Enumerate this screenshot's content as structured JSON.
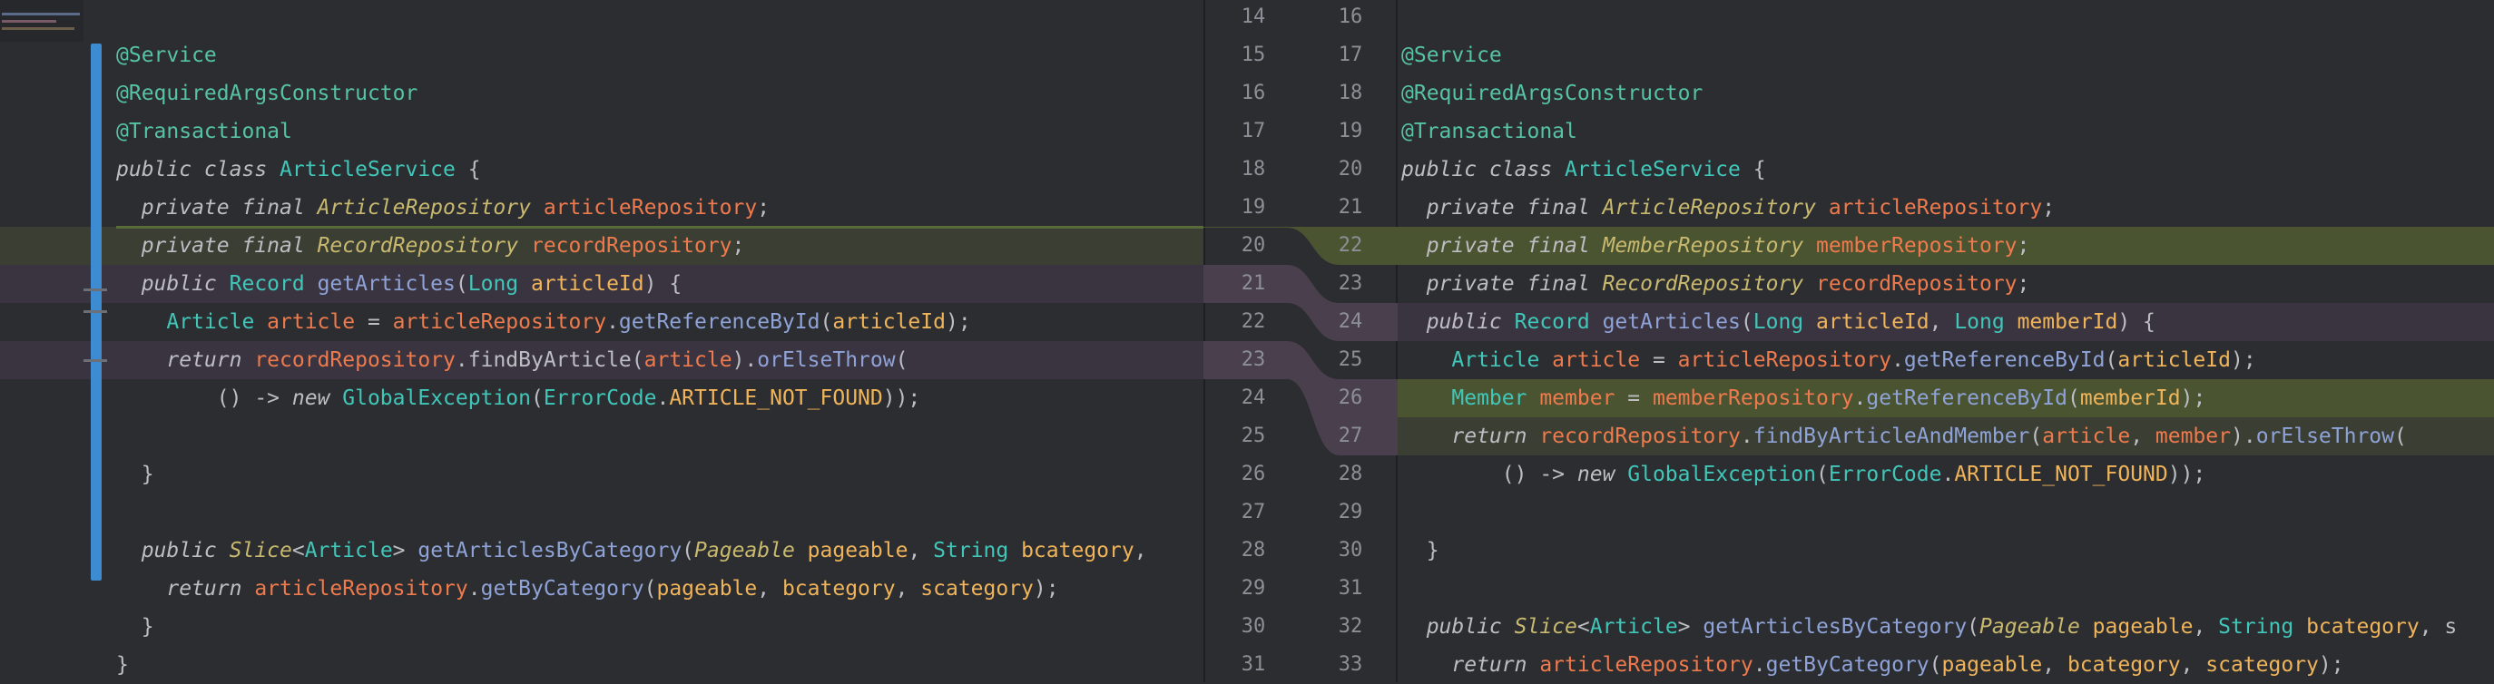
{
  "left": {
    "lines": [
      {
        "tokens": [
          [
            "ann",
            "@Service"
          ]
        ]
      },
      {
        "tokens": [
          [
            "ann",
            "@RequiredArgsConstructor"
          ]
        ]
      },
      {
        "tokens": [
          [
            "ann",
            "@Transactional"
          ]
        ]
      },
      {
        "tokens": [
          [
            "kw",
            "public class "
          ],
          [
            "cls",
            "ArticleService"
          ],
          [
            "plain",
            " {"
          ]
        ]
      },
      {
        "tokens": [
          [
            "kw",
            "  private final "
          ],
          [
            "ty",
            "ArticleRepository "
          ],
          [
            "fld",
            "articleRepository"
          ],
          [
            "plain",
            ";"
          ]
        ]
      },
      {
        "tokens": [
          [
            "kw",
            "  private final "
          ],
          [
            "ty",
            "RecordRepository "
          ],
          [
            "fld",
            "recordRepository"
          ],
          [
            "plain",
            ";"
          ]
        ]
      },
      {
        "tokens": [
          [
            "kw",
            "  public "
          ],
          [
            "cls",
            "Record "
          ],
          [
            "mth",
            "getArticles"
          ],
          [
            "plain",
            "("
          ],
          [
            "cls",
            "Long "
          ],
          [
            "var",
            "articleId"
          ],
          [
            "plain",
            ") {"
          ]
        ]
      },
      {
        "tokens": [
          [
            "plain",
            "    "
          ],
          [
            "cls",
            "Article "
          ],
          [
            "fld",
            "article"
          ],
          [
            "plain",
            " = "
          ],
          [
            "fld",
            "articleRepository"
          ],
          [
            "plain",
            "."
          ],
          [
            "mth",
            "getReferenceById"
          ],
          [
            "plain",
            "("
          ],
          [
            "var",
            "articleId"
          ],
          [
            "plain",
            ");"
          ]
        ]
      },
      {
        "tokens": [
          [
            "kw",
            "    return "
          ],
          [
            "fld",
            "recordRepository"
          ],
          [
            "plain",
            "."
          ],
          [
            "plain",
            "findByArticle"
          ],
          [
            "plain",
            "("
          ],
          [
            "fld",
            "article"
          ],
          [
            "plain",
            ")."
          ],
          [
            "mth",
            "orElseThrow"
          ],
          [
            "plain",
            "("
          ]
        ]
      },
      {
        "tokens": [
          [
            "plain",
            "        () -> "
          ],
          [
            "kw",
            "new "
          ],
          [
            "cls",
            "GlobalException"
          ],
          [
            "plain",
            "("
          ],
          [
            "cls",
            "ErrorCode"
          ],
          [
            "plain",
            "."
          ],
          [
            "cst",
            "ARTICLE_NOT_FOUND"
          ],
          [
            "plain",
            "));"
          ]
        ]
      },
      {
        "tokens": [
          [
            "plain",
            ""
          ]
        ]
      },
      {
        "tokens": [
          [
            "plain",
            "  }"
          ]
        ]
      },
      {
        "tokens": [
          [
            "plain",
            ""
          ]
        ]
      },
      {
        "tokens": [
          [
            "kw",
            "  public "
          ],
          [
            "ty",
            "Slice"
          ],
          [
            "plain",
            "<"
          ],
          [
            "cls",
            "Article"
          ],
          [
            "plain",
            "> "
          ],
          [
            "mth",
            "getArticlesByCategory"
          ],
          [
            "plain",
            "("
          ],
          [
            "ty",
            "Pageable "
          ],
          [
            "var",
            "pageable"
          ],
          [
            "plain",
            ", "
          ],
          [
            "cls",
            "String "
          ],
          [
            "var",
            "bcategory"
          ],
          [
            "plain",
            ","
          ]
        ]
      },
      {
        "tokens": [
          [
            "kw",
            "    return "
          ],
          [
            "fld",
            "articleRepository"
          ],
          [
            "plain",
            "."
          ],
          [
            "mth",
            "getByCategory"
          ],
          [
            "plain",
            "("
          ],
          [
            "var",
            "pageable"
          ],
          [
            "plain",
            ", "
          ],
          [
            "var",
            "bcategory"
          ],
          [
            "plain",
            ", "
          ],
          [
            "var",
            "scategory"
          ],
          [
            "plain",
            ");"
          ]
        ]
      },
      {
        "tokens": [
          [
            "plain",
            "  }"
          ]
        ]
      },
      {
        "tokens": [
          [
            "plain",
            "}"
          ]
        ]
      }
    ]
  },
  "right": {
    "lines": [
      {
        "tokens": [
          [
            "plain",
            ""
          ]
        ]
      },
      {
        "tokens": [
          [
            "ann",
            "@Service"
          ]
        ]
      },
      {
        "tokens": [
          [
            "ann",
            "@RequiredArgsConstructor"
          ]
        ]
      },
      {
        "tokens": [
          [
            "ann",
            "@Transactional"
          ]
        ]
      },
      {
        "tokens": [
          [
            "kw",
            "public class "
          ],
          [
            "cls",
            "ArticleService"
          ],
          [
            "plain",
            " {"
          ]
        ]
      },
      {
        "tokens": [
          [
            "kw",
            "  private final "
          ],
          [
            "ty",
            "ArticleRepository "
          ],
          [
            "fld",
            "articleRepository"
          ],
          [
            "plain",
            ";"
          ]
        ]
      },
      {
        "tokens": [
          [
            "kw",
            "  private final "
          ],
          [
            "ty",
            "MemberRepository "
          ],
          [
            "fld",
            "memberRepository"
          ],
          [
            "plain",
            ";"
          ]
        ]
      },
      {
        "tokens": [
          [
            "kw",
            "  private final "
          ],
          [
            "ty",
            "RecordRepository "
          ],
          [
            "fld",
            "recordRepository"
          ],
          [
            "plain",
            ";"
          ]
        ]
      },
      {
        "tokens": [
          [
            "kw",
            "  public "
          ],
          [
            "cls",
            "Record "
          ],
          [
            "mth",
            "getArticles"
          ],
          [
            "plain",
            "("
          ],
          [
            "cls",
            "Long "
          ],
          [
            "var",
            "articleId"
          ],
          [
            "plain",
            ", "
          ],
          [
            "cls",
            "Long "
          ],
          [
            "var",
            "memberId"
          ],
          [
            "plain",
            ") {"
          ]
        ]
      },
      {
        "tokens": [
          [
            "plain",
            "    "
          ],
          [
            "cls",
            "Article "
          ],
          [
            "fld",
            "article"
          ],
          [
            "plain",
            " = "
          ],
          [
            "fld",
            "articleRepository"
          ],
          [
            "plain",
            "."
          ],
          [
            "mth",
            "getReferenceById"
          ],
          [
            "plain",
            "("
          ],
          [
            "var",
            "articleId"
          ],
          [
            "plain",
            ");"
          ]
        ]
      },
      {
        "tokens": [
          [
            "plain",
            "    "
          ],
          [
            "cls",
            "Member "
          ],
          [
            "fld",
            "member"
          ],
          [
            "plain",
            " = "
          ],
          [
            "fld",
            "memberRepository"
          ],
          [
            "plain",
            "."
          ],
          [
            "mth",
            "getReferenceById"
          ],
          [
            "plain",
            "("
          ],
          [
            "var",
            "memberId"
          ],
          [
            "plain",
            ");"
          ]
        ]
      },
      {
        "tokens": [
          [
            "kw",
            "    return "
          ],
          [
            "fld",
            "recordRepository"
          ],
          [
            "plain",
            "."
          ],
          [
            "mth",
            "findByArticleAndMember"
          ],
          [
            "plain",
            "("
          ],
          [
            "fld",
            "article"
          ],
          [
            "plain",
            ", "
          ],
          [
            "fld",
            "member"
          ],
          [
            "plain",
            ")."
          ],
          [
            "mth",
            "orElseThrow"
          ],
          [
            "plain",
            "("
          ]
        ]
      },
      {
        "tokens": [
          [
            "plain",
            "        () -> "
          ],
          [
            "kw",
            "new "
          ],
          [
            "cls",
            "GlobalException"
          ],
          [
            "plain",
            "("
          ],
          [
            "cls",
            "ErrorCode"
          ],
          [
            "plain",
            "."
          ],
          [
            "cst",
            "ARTICLE_NOT_FOUND"
          ],
          [
            "plain",
            "));"
          ]
        ]
      },
      {
        "tokens": [
          [
            "plain",
            ""
          ]
        ]
      },
      {
        "tokens": [
          [
            "plain",
            "  }"
          ]
        ]
      },
      {
        "tokens": [
          [
            "plain",
            ""
          ]
        ]
      },
      {
        "tokens": [
          [
            "kw",
            "  public "
          ],
          [
            "ty",
            "Slice"
          ],
          [
            "plain",
            "<"
          ],
          [
            "cls",
            "Article"
          ],
          [
            "plain",
            "> "
          ],
          [
            "mth",
            "getArticlesByCategory"
          ],
          [
            "plain",
            "("
          ],
          [
            "ty",
            "Pageable "
          ],
          [
            "var",
            "pageable"
          ],
          [
            "plain",
            ", "
          ],
          [
            "cls",
            "String "
          ],
          [
            "var",
            "bcategory"
          ],
          [
            "plain",
            ", s"
          ]
        ]
      },
      {
        "tokens": [
          [
            "kw",
            "    return "
          ],
          [
            "fld",
            "articleRepository"
          ],
          [
            "plain",
            "."
          ],
          [
            "mth",
            "getByCategory"
          ],
          [
            "plain",
            "("
          ],
          [
            "var",
            "pageable"
          ],
          [
            "plain",
            ", "
          ],
          [
            "var",
            "bcategory"
          ],
          [
            "plain",
            ", "
          ],
          [
            "var",
            "scategory"
          ],
          [
            "plain",
            ");"
          ]
        ]
      }
    ]
  },
  "gutter": {
    "left_numbers": [
      "14",
      "15",
      "16",
      "17",
      "18",
      "19",
      "20",
      "21",
      "22",
      "23",
      "24",
      "25",
      "26",
      "27",
      "28",
      "29",
      "30",
      "31"
    ],
    "right_numbers": [
      "16",
      "17",
      "18",
      "19",
      "20",
      "21",
      "22",
      "23",
      "24",
      "25",
      "26",
      "27",
      "28",
      "29",
      "30",
      "31",
      "32",
      "33"
    ]
  }
}
